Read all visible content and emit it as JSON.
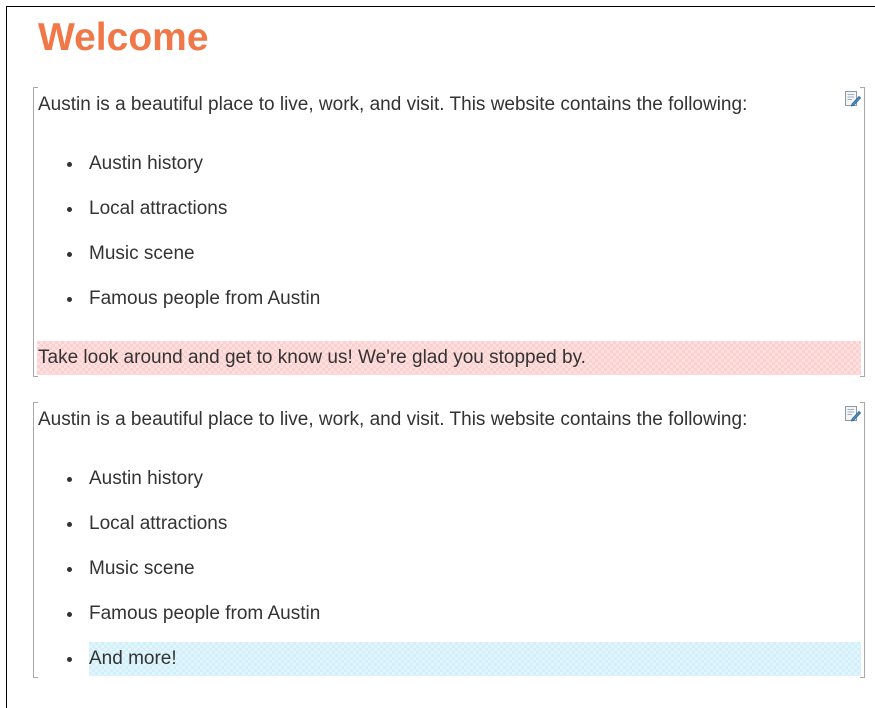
{
  "page": {
    "title": "Welcome",
    "accent_color": "#f07848"
  },
  "blocks": [
    {
      "intro": "Austin is a beautiful place to live, work, and visit. This website contains the following:",
      "edit_icon": "edit-page-icon",
      "items": [
        "Austin history",
        "Local attractions",
        "Music scene",
        "Famous people from Austin"
      ],
      "closing": "Take look around and get to know us! We're glad you stopped by.",
      "closing_highlight_color": "#fdd0d0"
    },
    {
      "intro": "Austin is a beautiful place to live, work, and visit. This website contains the following:",
      "edit_icon": "edit-page-icon",
      "items": [
        "Austin history",
        "Local attractions",
        "Music scene",
        "Famous people from Austin",
        "And more!"
      ],
      "last_item_highlight_color": "#d2f0fa"
    }
  ]
}
